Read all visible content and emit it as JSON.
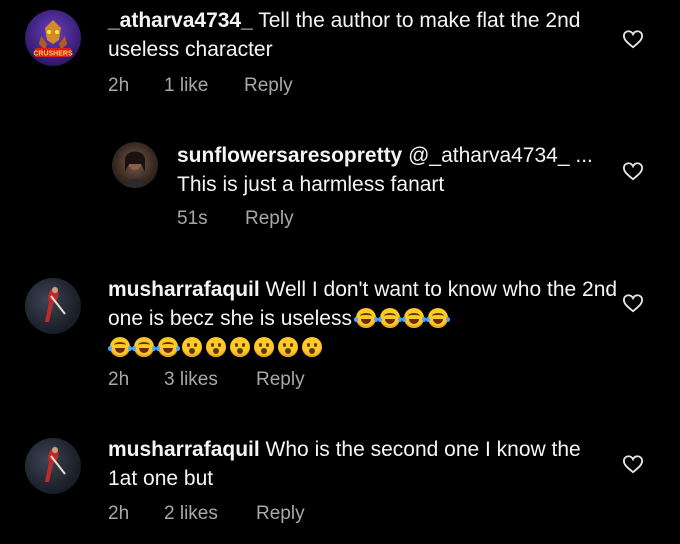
{
  "comments": [
    {
      "username": "_atharva4734_",
      "text": " Tell the author to make flat the 2nd useless character",
      "time": "2h",
      "likes": "1 like",
      "reply": "Reply",
      "avatar_label": "CRUSHERS"
    },
    {
      "username": "sunflowersaresopretty",
      "text": " @_atharva4734_ ... This is just a harmless fanart",
      "time": "51s",
      "likes": "",
      "reply": "Reply"
    },
    {
      "username": "musharrafaquil",
      "text": " Well I don't want to know who the 2nd one is becz she is useless",
      "time": "2h",
      "likes": "3 likes",
      "reply": "Reply"
    },
    {
      "username": "musharrafaquil",
      "text": " Who is the second one I know the 1at one but",
      "time": "2h",
      "likes": "2 likes",
      "reply": "Reply"
    }
  ],
  "icons": {
    "like": "heart-outline-icon",
    "laugh_emoji": "face-with-tears-of-joy",
    "wow_emoji": "face-with-open-mouth"
  },
  "colors": {
    "background": "#000000",
    "text": "#f5f5f5",
    "meta": "#a8a8a8"
  }
}
